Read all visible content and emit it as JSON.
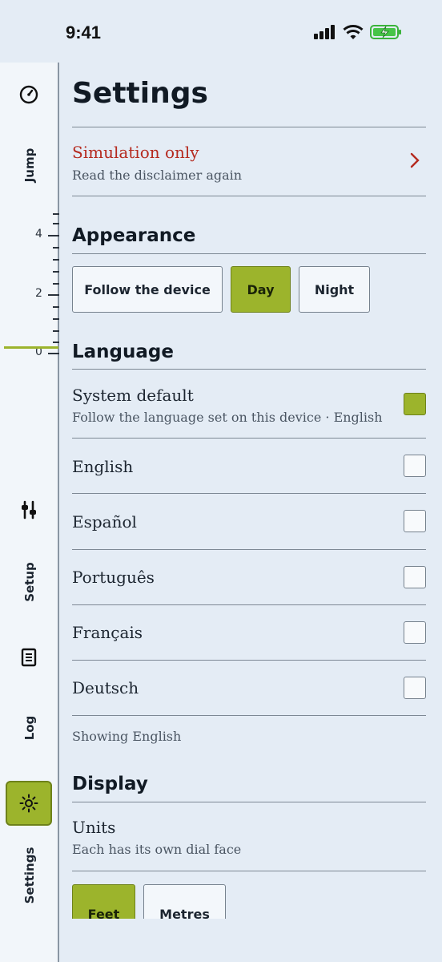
{
  "status": {
    "time": "9:41"
  },
  "rail": {
    "items": [
      {
        "label": "Jump",
        "icon": "gauge-icon"
      },
      {
        "label": "Setup",
        "icon": "sliders-icon"
      },
      {
        "label": "Log",
        "icon": "log-document-icon"
      },
      {
        "label": "Settings",
        "icon": "sun-icon",
        "active": true
      }
    ],
    "altimeter_ticks": [
      "4",
      "2",
      "0"
    ],
    "accent": "#9cb42c"
  },
  "page": {
    "title": "Settings",
    "disclaimer": {
      "title": "Simulation only",
      "subtitle": "Read the disclaimer again",
      "title_color": "#b52a1f"
    },
    "appearance": {
      "heading": "Appearance",
      "options": [
        "Follow the device",
        "Day",
        "Night"
      ],
      "selected": "Day"
    },
    "language": {
      "heading": "Language",
      "system": {
        "label": "System default",
        "subtitle": "Follow the language set on this device · English",
        "checked": true
      },
      "options": [
        {
          "label": "English",
          "checked": false
        },
        {
          "label": "Español",
          "checked": false
        },
        {
          "label": "Português",
          "checked": false
        },
        {
          "label": "Français",
          "checked": false
        },
        {
          "label": "Deutsch",
          "checked": false
        }
      ],
      "showing": "Showing English"
    },
    "display": {
      "heading": "Display",
      "units_label": "Units",
      "units_subtitle": "Each has its own dial face",
      "unit_options": [
        "Feet",
        "Metres"
      ],
      "selected_unit": "Feet"
    }
  }
}
